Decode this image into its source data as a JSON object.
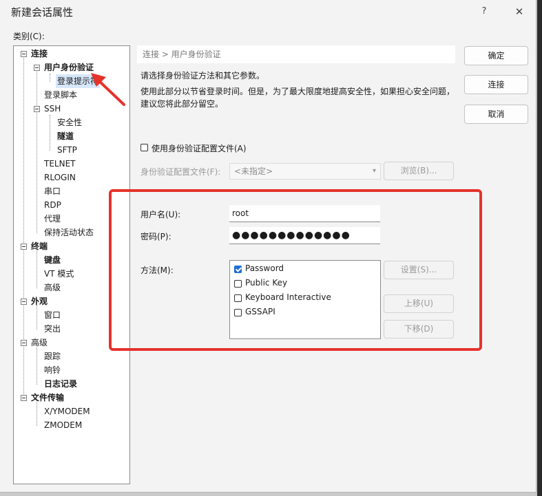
{
  "window": {
    "title": "新建会话属性",
    "help": "?",
    "close": "✕"
  },
  "category_label": "类别(C):",
  "tree": [
    {
      "label": "连接",
      "bold": true
    },
    {
      "label": "用户身份验证",
      "bold": true
    },
    {
      "label": "登录提示符",
      "bold": false
    },
    {
      "label": "登录脚本",
      "bold": false
    },
    {
      "label": "SSH",
      "bold": false
    },
    {
      "label": "安全性",
      "bold": false
    },
    {
      "label": "隧道",
      "bold": true
    },
    {
      "label": "SFTP",
      "bold": false
    },
    {
      "label": "TELNET",
      "bold": false
    },
    {
      "label": "RLOGIN",
      "bold": false
    },
    {
      "label": "串口",
      "bold": false
    },
    {
      "label": "RDP",
      "bold": false
    },
    {
      "label": "代理",
      "bold": false
    },
    {
      "label": "保持活动状态",
      "bold": false
    },
    {
      "label": "终端",
      "bold": true
    },
    {
      "label": "键盘",
      "bold": true
    },
    {
      "label": "VT 模式",
      "bold": false
    },
    {
      "label": "高级",
      "bold": false
    },
    {
      "label": "外观",
      "bold": true
    },
    {
      "label": "窗口",
      "bold": false
    },
    {
      "label": "突出",
      "bold": false
    },
    {
      "label": "高级",
      "bold": false
    },
    {
      "label": "跟踪",
      "bold": false
    },
    {
      "label": "响铃",
      "bold": false
    },
    {
      "label": "日志记录",
      "bold": true
    },
    {
      "label": "文件传输",
      "bold": true
    },
    {
      "label": "X/YMODEM",
      "bold": false
    },
    {
      "label": "ZMODEM",
      "bold": false
    }
  ],
  "breadcrumb": "连接 > 用户身份验证",
  "description": {
    "line1": "请选择身份验证方法和其它参数。",
    "line2": "使用此部分以节省登录时间。但是，为了最大限度地提高安全性，如果担心安全问题，",
    "line3": "建议您将此部分留空。"
  },
  "buttons": {
    "ok": "确定",
    "connect": "连接",
    "cancel": "取消"
  },
  "profile": {
    "checkbox_label": "使用身份验证配置文件(A)",
    "file_label": "身份验证配置文件(F):",
    "file_value": "<未指定>",
    "browse": "浏览(B)..."
  },
  "username": {
    "label": "用户名(U):",
    "value": "root"
  },
  "password": {
    "label": "密码(P):",
    "value": "●●●●●●●●●●●●●"
  },
  "method": {
    "label": "方法(M):",
    "options": [
      {
        "label": "Password",
        "checked": true
      },
      {
        "label": "Public Key",
        "checked": false
      },
      {
        "label": "Keyboard Interactive",
        "checked": false
      },
      {
        "label": "GSSAPI",
        "checked": false
      }
    ],
    "settings": "设置(S)...",
    "move_up": "上移(U)",
    "move_down": "下移(D)"
  },
  "colors": {
    "annotation_red": "#e5322b",
    "checkbox_blue": "#1f6fd6"
  }
}
